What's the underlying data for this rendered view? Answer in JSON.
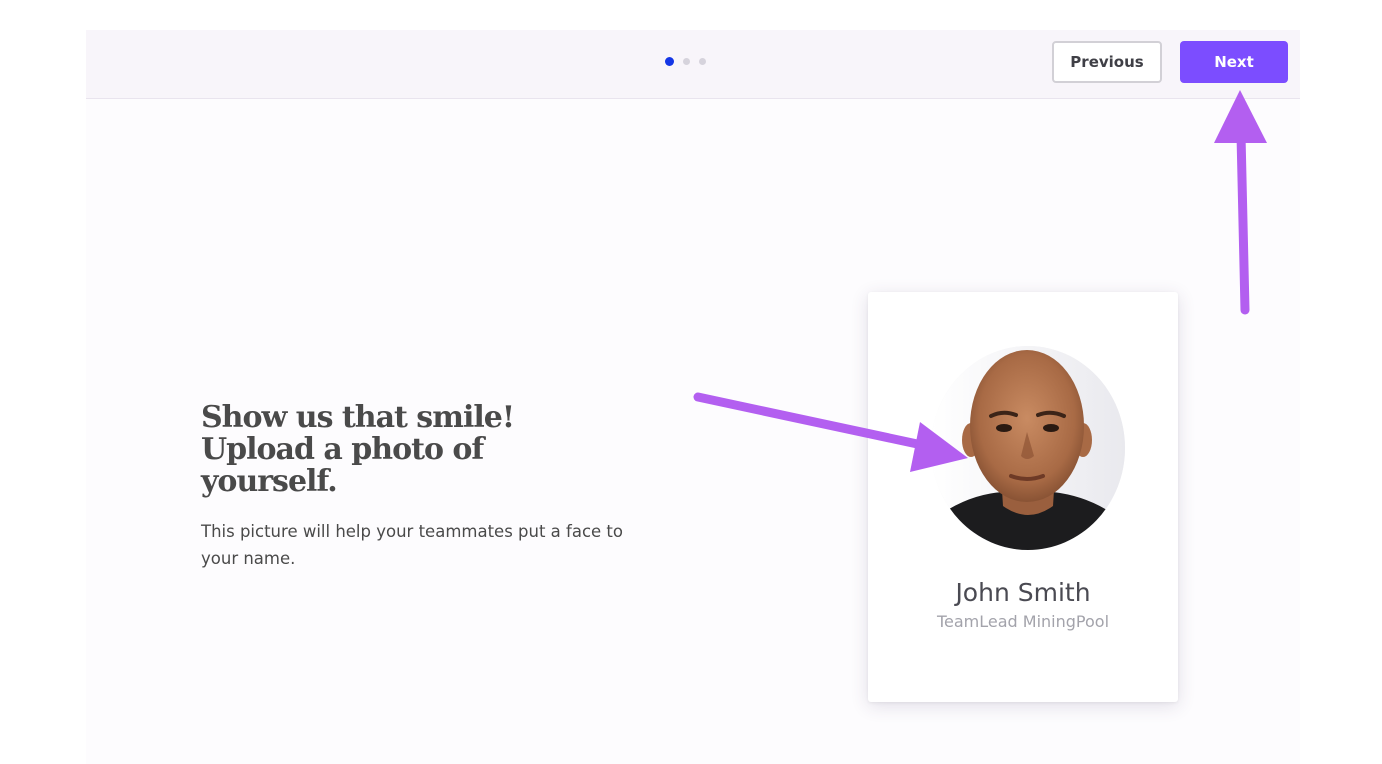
{
  "header": {
    "steps": [
      {
        "state": "active"
      },
      {
        "state": "inactive"
      },
      {
        "state": "inactive"
      }
    ],
    "previous_label": "Previous",
    "next_label": "Next"
  },
  "main": {
    "headline": "Show us that smile! Upload a photo of yourself.",
    "subtext": "This picture will help your teammates put a face to your name."
  },
  "profile_card": {
    "name": "John Smith",
    "role": "TeamLead MiningPool"
  },
  "colors": {
    "accent": "#7c4dff",
    "active_step": "#1436e6",
    "annotation_arrow": "#b35ff0"
  },
  "annotations": {
    "icons": [
      "arrow-up-icon",
      "arrow-right-icon"
    ]
  }
}
